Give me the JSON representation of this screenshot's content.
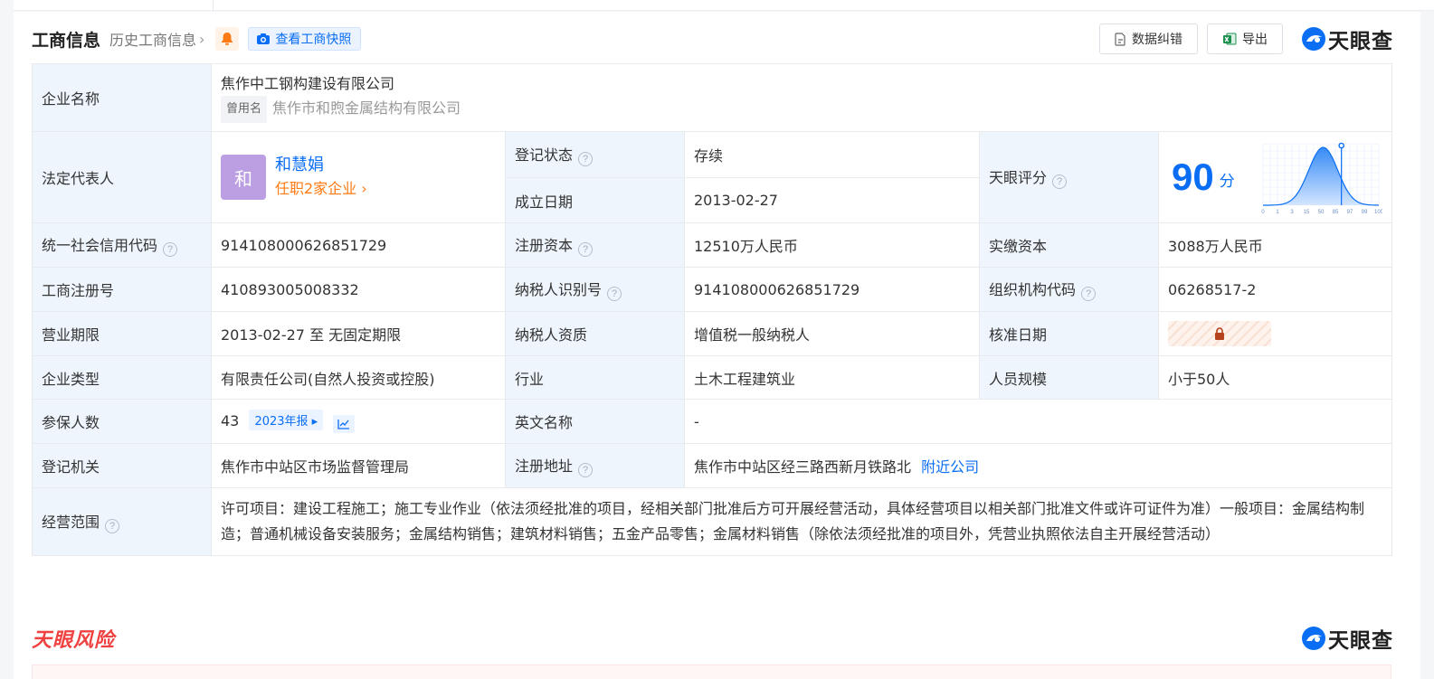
{
  "header": {
    "title": "工商信息",
    "history": "历史工商信息",
    "snapshot": "查看工商快照",
    "correct_btn": "数据纠错",
    "export_btn": "导出",
    "logo": "天眼查"
  },
  "rows": {
    "company_name_label": "企业名称",
    "company_name": "焦作中工钢构建设有限公司",
    "former_tag": "曾用名",
    "former_name": "焦作市和煦金属结构有限公司",
    "legal_label": "法定代表人",
    "legal_avatar": "和",
    "legal_name": "和慧娟",
    "legal_sub": "任职2家企业",
    "status_label": "登记状态",
    "status_value": "存续",
    "found_label": "成立日期",
    "found_value": "2013-02-27",
    "score_label": "天眼评分",
    "score_value": "90",
    "score_unit": "分",
    "credit_label": "统一社会信用代码",
    "credit_value": "914108000626851729",
    "capital_label": "注册资本",
    "capital_value": "12510万人民币",
    "paid_label": "实缴资本",
    "paid_value": "3088万人民币",
    "regno_label": "工商注册号",
    "regno_value": "410893005008332",
    "taxid_label": "纳税人识别号",
    "taxid_value": "914108000626851729",
    "org_label": "组织机构代码",
    "org_value": "06268517-2",
    "term_label": "营业期限",
    "term_value": "2013-02-27 至 无固定期限",
    "taxq_label": "纳税人资质",
    "taxq_value": "增值税一般纳税人",
    "approve_label": "核准日期",
    "type_label": "企业类型",
    "type_value": "有限责任公司(自然人投资或控股)",
    "industry_label": "行业",
    "industry_value": "土木工程建筑业",
    "staff_label": "人员规模",
    "staff_value": "小于50人",
    "insured_label": "参保人数",
    "insured_value": "43",
    "report_tag": "2023年报",
    "en_label": "英文名称",
    "en_value": "-",
    "authority_label": "登记机关",
    "authority_value": "焦作市中站区市场监督管理局",
    "addr_label": "注册地址",
    "addr_value": "焦作市中站区经三路西新月铁路北",
    "nearby_link": "附近公司",
    "scope_label": "经营范围",
    "scope_value": "许可项目：建设工程施工；施工专业作业（依法须经批准的项目，经相关部门批准后方可开展经营活动，具体经营项目以相关部门批准文件或许可证件为准）一般项目：金属结构制造；普通机械设备安装服务；金属结构销售；建筑材料销售；五金产品零售；金属材料销售（除依法须经批准的项目外，凭营业执照依法自主开展经营活动）"
  },
  "score_chart": {
    "ticks": [
      "0",
      "1",
      "3",
      "15",
      "50",
      "85",
      "97",
      "99",
      "100"
    ],
    "marker": 90
  },
  "risk": {
    "title": "天眼风险",
    "logo": "天眼查"
  },
  "colors": {
    "accent": "#0a6ef5",
    "status_green": "#1aa260",
    "orange": "#ff7a13",
    "risk_red": "#f04141",
    "label_bg": "#eef5fd"
  }
}
